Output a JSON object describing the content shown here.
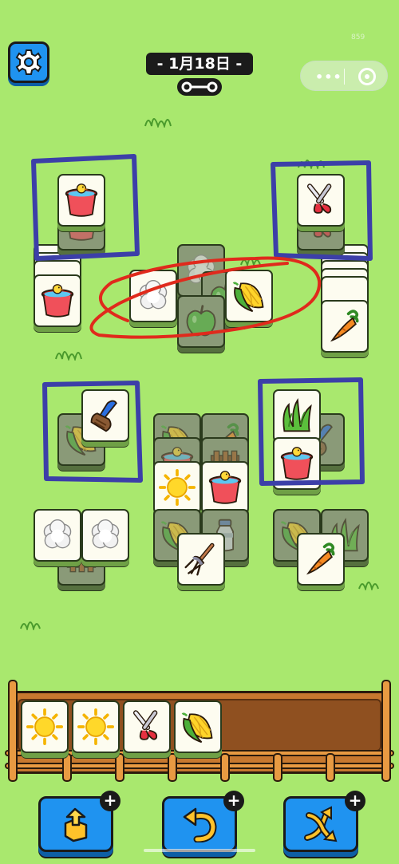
{
  "header": {
    "date_label": "- 1月18日 -",
    "fps_text": "859"
  },
  "icons": {
    "settings": "gear-icon",
    "key": "key-icon",
    "capsule_more": "more-dots-icon",
    "capsule_close": "target-close-icon"
  },
  "colors": {
    "background": "#a9e86e",
    "button_blue": "#1f93f0",
    "tile_face": "#fdfcf0",
    "tray_wood": "#c7782f",
    "annotation_blue": "#3c3fa8",
    "annotation_red": "#e02a1c"
  },
  "board": {
    "tiles": [
      {
        "item": "chick-bucket",
        "state": "dim"
      },
      {
        "item": "chick-bucket",
        "state": "active"
      },
      {
        "item": "chick-bucket",
        "state": "active"
      },
      {
        "item": "shears",
        "state": "dim"
      },
      {
        "item": "shears",
        "state": "active"
      },
      {
        "item": "carrot",
        "state": "active"
      },
      {
        "item": "cotton",
        "state": "dim"
      },
      {
        "item": "apple",
        "state": "dim"
      },
      {
        "item": "apple",
        "state": "dim"
      },
      {
        "item": "cotton",
        "state": "active"
      },
      {
        "item": "corn",
        "state": "active"
      },
      {
        "item": "corn",
        "state": "dim"
      },
      {
        "item": "brush",
        "state": "active"
      },
      {
        "item": "corn",
        "state": "dim"
      },
      {
        "item": "carrot",
        "state": "dim"
      },
      {
        "item": "chick-bucket",
        "state": "dim"
      },
      {
        "item": "fence",
        "state": "dim"
      },
      {
        "item": "sun",
        "state": "active"
      },
      {
        "item": "chick-bucket",
        "state": "active"
      },
      {
        "item": "corn",
        "state": "dim"
      },
      {
        "item": "milk-can",
        "state": "dim"
      },
      {
        "item": "pitchfork",
        "state": "active"
      },
      {
        "item": "brush",
        "state": "dim"
      },
      {
        "item": "grass",
        "state": "active"
      },
      {
        "item": "chick-bucket",
        "state": "active"
      },
      {
        "item": "fence",
        "state": "dim"
      },
      {
        "item": "cotton",
        "state": "active"
      },
      {
        "item": "cotton",
        "state": "active"
      },
      {
        "item": "corn",
        "state": "dim"
      },
      {
        "item": "grass",
        "state": "dim"
      },
      {
        "item": "carrot",
        "state": "active"
      }
    ]
  },
  "slot_tray": {
    "capacity": 7,
    "items": [
      "sun",
      "sun",
      "shears",
      "corn"
    ]
  },
  "toolbar": {
    "buttons": [
      {
        "name": "move-out",
        "icon": "box-out-icon",
        "badge": "+"
      },
      {
        "name": "undo",
        "icon": "undo-arrow-icon",
        "badge": "+"
      },
      {
        "name": "shuffle",
        "icon": "shuffle-icon",
        "badge": "+"
      }
    ]
  }
}
